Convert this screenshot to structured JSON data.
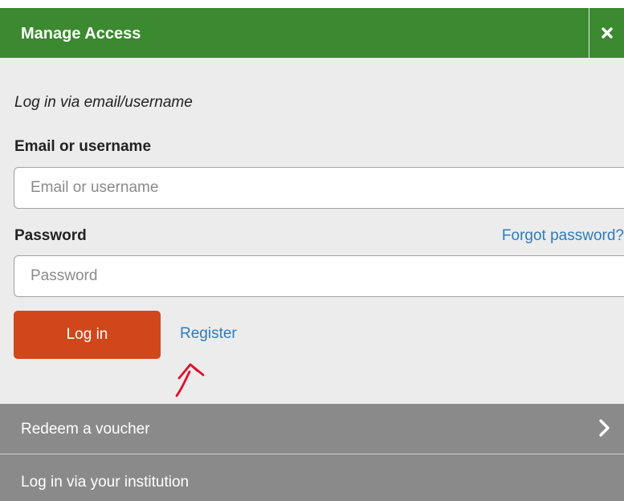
{
  "header": {
    "title": "Manage Access",
    "close_icon": "close-icon"
  },
  "login": {
    "subtitle": "Log in via email/username",
    "email_label": "Email or username",
    "email_placeholder": "Email or username",
    "email_value": "",
    "password_label": "Password",
    "password_placeholder": "Password",
    "password_value": "",
    "forgot_label": "Forgot password?",
    "login_button": "Log in",
    "register_link": "Register"
  },
  "options": [
    {
      "label": "Redeem a voucher",
      "icon": "chevron-right-icon"
    },
    {
      "label": "Log in via your institution"
    }
  ],
  "colors": {
    "header_bg": "#3b8a2f",
    "login_button_bg": "#d2461b",
    "link": "#2e7bbf",
    "option_row_bg": "#8a8a8a",
    "annotation_arrow": "#e0102a"
  }
}
